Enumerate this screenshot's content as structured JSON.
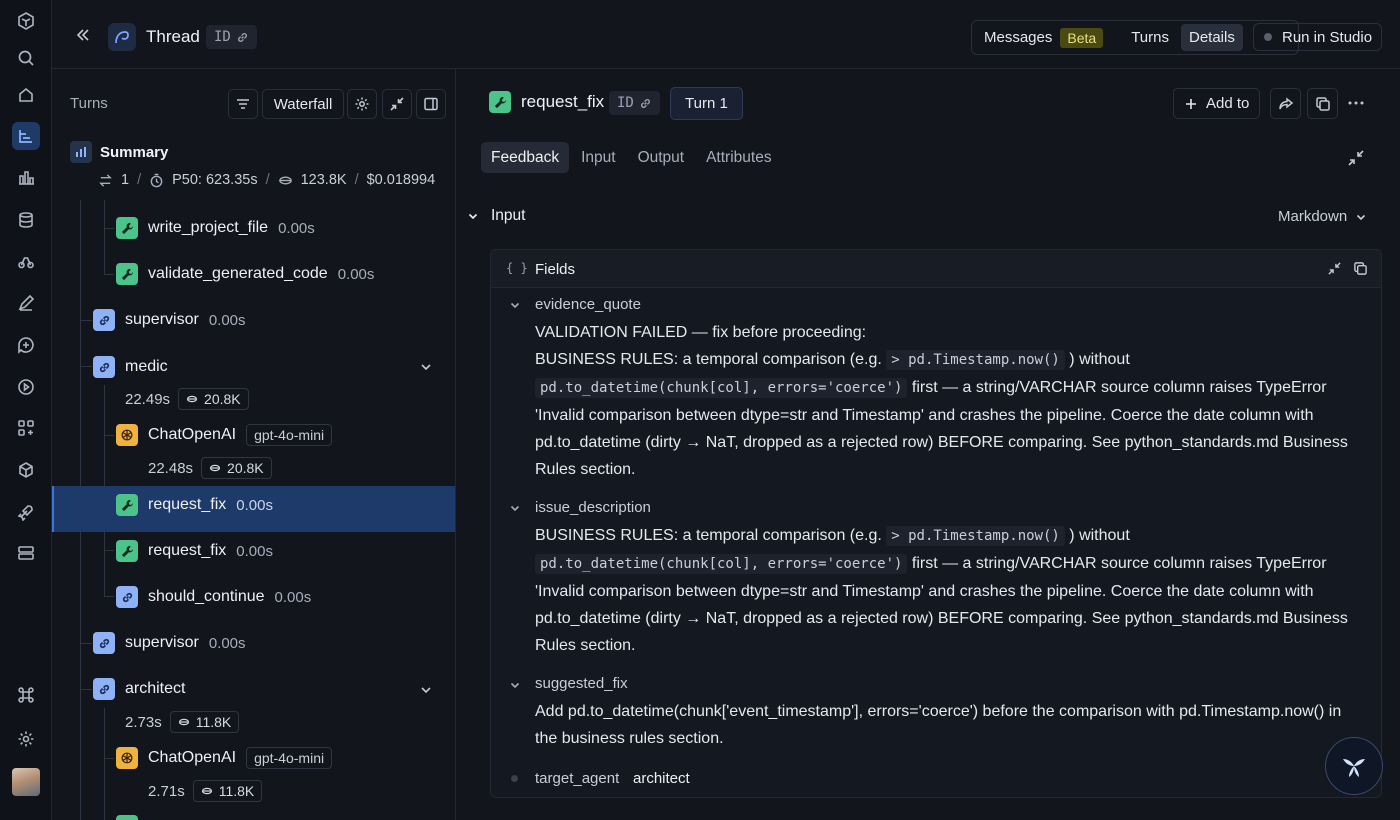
{
  "header": {
    "title": "Thread",
    "id_label": "ID",
    "view_tabs": [
      {
        "label": "Messages",
        "badge": "Beta"
      },
      {
        "label": "Turns"
      },
      {
        "label": "Details",
        "active": true
      }
    ],
    "run_in_studio": "Run in Studio"
  },
  "turns_panel": {
    "title": "Turns",
    "view_mode": "Waterfall",
    "summary": {
      "label": "Summary",
      "turn_count": "1",
      "p50": "P50: 623.35s",
      "tokens": "123.8K",
      "cost": "$0.018994"
    },
    "nodes": [
      {
        "name": "write_project_file",
        "time": "0.00s",
        "kind": "tool"
      },
      {
        "name": "validate_generated_code",
        "time": "0.00s",
        "kind": "tool"
      },
      {
        "name": "supervisor",
        "time": "0.00s",
        "kind": "chain"
      },
      {
        "name": "medic",
        "time": "",
        "kind": "chain",
        "duration": "22.49s",
        "tokens": "20.8K"
      },
      {
        "name": "ChatOpenAI",
        "model": "gpt-4o-mini",
        "kind": "llm",
        "duration": "22.48s",
        "tokens": "20.8K"
      },
      {
        "name": "request_fix",
        "time": "0.00s",
        "kind": "tool",
        "selected": true
      },
      {
        "name": "request_fix",
        "time": "0.00s",
        "kind": "tool"
      },
      {
        "name": "should_continue",
        "time": "0.00s",
        "kind": "chain"
      },
      {
        "name": "supervisor",
        "time": "0.00s",
        "kind": "chain"
      },
      {
        "name": "architect",
        "time": "",
        "kind": "chain",
        "duration": "2.73s",
        "tokens": "11.8K"
      },
      {
        "name": "ChatOpenAI",
        "model": "gpt-4o-mini",
        "kind": "llm",
        "duration": "2.71s",
        "tokens": "11.8K"
      }
    ]
  },
  "details": {
    "run_name": "request_fix",
    "id_label": "ID",
    "turn_label": "Turn 1",
    "add_to": "Add to",
    "tabs": [
      "Feedback",
      "Input",
      "Output",
      "Attributes"
    ],
    "active_tab": "Feedback",
    "section": "Input",
    "format": "Markdown",
    "fields_label": "Fields",
    "fields": {
      "evidence_quote": {
        "key": "evidence_quote",
        "line1": "VALIDATION FAILED — fix before proceeding:",
        "line2_pre": "BUSINESS RULES: a temporal comparison (e.g.",
        "line2_code": "> pd.Timestamp.now()",
        "line2_post": ") without",
        "line3_code": "pd.to_datetime(chunk[col], errors='coerce')",
        "line3_post": "first — a string/VARCHAR source column raises TypeError",
        "line4": "'Invalid comparison between dtype=str and Timestamp' and crashes the pipeline. Coerce the date column with",
        "line5": "pd.to_datetime (dirty → NaT, dropped as a rejected row) BEFORE comparing. See python_standards.md Business",
        "line6": "Rules section."
      },
      "issue_description": {
        "key": "issue_description",
        "line1_pre": "BUSINESS RULES: a temporal comparison (e.g.",
        "line1_code": "> pd.Timestamp.now()",
        "line1_post": ") without",
        "line2_code": "pd.to_datetime(chunk[col], errors='coerce')",
        "line2_post": "first — a string/VARCHAR source column raises TypeError",
        "line3": "'Invalid comparison between dtype=str and Timestamp' and crashes the pipeline. Coerce the date column with",
        "line4": "pd.to_datetime (dirty → NaT, dropped as a rejected row) BEFORE comparing. See python_standards.md Business",
        "line5": "Rules section."
      },
      "suggested_fix": {
        "key": "suggested_fix",
        "line1": "Add pd.to_datetime(chunk['event_timestamp'], errors='coerce') before the comparison with pd.Timestamp.now() in",
        "line2": "the business rules section."
      },
      "target_agent": {
        "key": "target_agent",
        "value": "architect"
      }
    }
  }
}
